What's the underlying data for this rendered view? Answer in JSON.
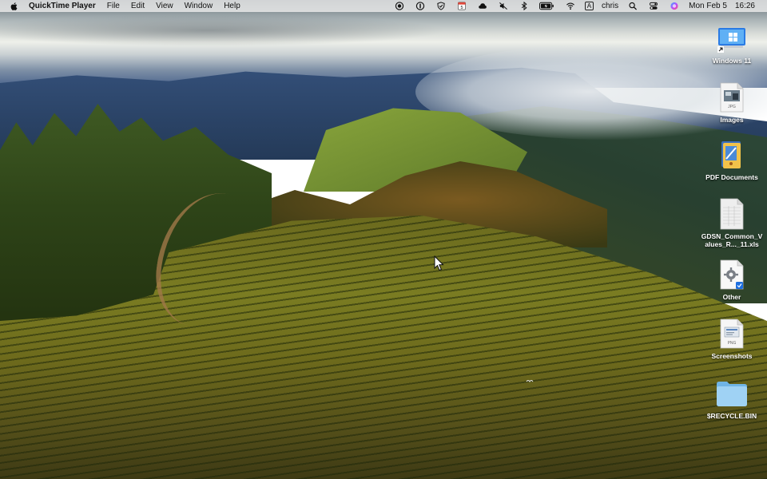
{
  "menubar": {
    "app_name": "QuickTime Player",
    "menus": [
      "File",
      "Edit",
      "View",
      "Window",
      "Help"
    ],
    "status_icons": [
      "record-icon",
      "onepassword-icon",
      "shield-icon",
      "calendar-icon",
      "cloud-icon",
      "mute-icon",
      "bluetooth-icon",
      "battery-icon",
      "wifi-icon"
    ],
    "calendar_day": "5",
    "input_source": "A",
    "user": "chris",
    "status_icons_right": [
      "search-icon",
      "control-center-icon",
      "siri-icon"
    ],
    "date": "Mon Feb 5",
    "time": "16:26"
  },
  "desktop": {
    "icons": [
      {
        "label": "Windows 11",
        "icon": "windows-app-icon"
      },
      {
        "label": "Images",
        "icon": "jpg-file-icon",
        "badge": "JPG"
      },
      {
        "label": "PDF Documents",
        "icon": "pdf-documents-icon"
      },
      {
        "label": "GDSN_Common_Values_R..._11.xls",
        "icon": "spreadsheet-file-icon"
      },
      {
        "label": "Other",
        "icon": "settings-document-icon"
      },
      {
        "label": "Screenshots",
        "icon": "png-file-icon",
        "badge": "PNG"
      },
      {
        "label": "$RECYCLE.BIN",
        "icon": "folder-icon"
      }
    ]
  },
  "colors": {
    "menubar_bg": "#ececec",
    "folder_blue": "#8ec9ee",
    "windows_blue": "#1f6fd6"
  }
}
